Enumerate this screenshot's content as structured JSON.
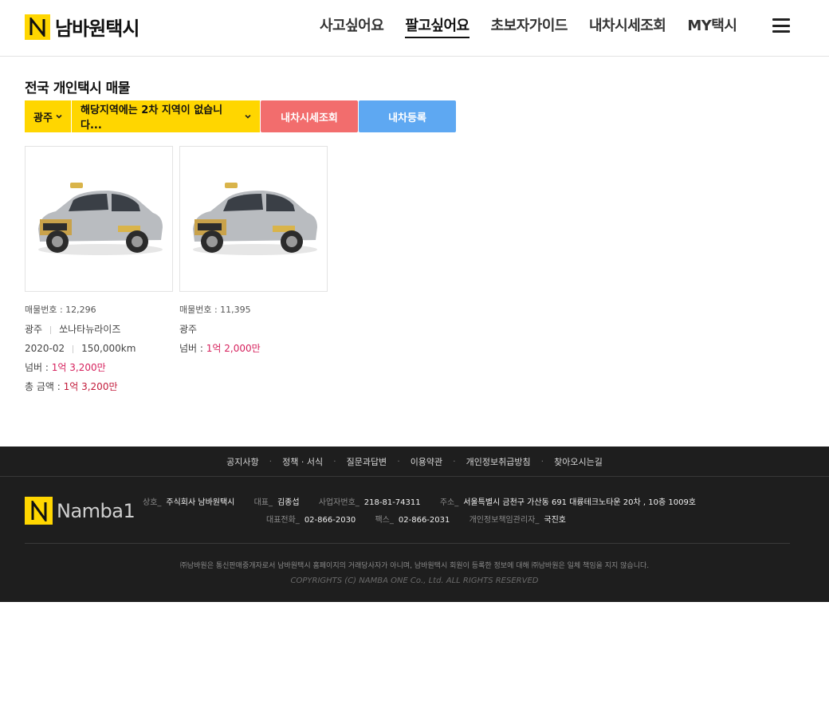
{
  "brand": {
    "name": "남바원택시",
    "footer_name": "Namba1"
  },
  "nav": {
    "items": [
      {
        "label": "사고싶어요",
        "active": false
      },
      {
        "label": "팔고싶어요",
        "active": true
      },
      {
        "label": "초보자가이드",
        "active": false
      },
      {
        "label": "내차시세조회",
        "active": false
      },
      {
        "label": "MY택시",
        "active": false
      }
    ]
  },
  "main": {
    "title": "전국 개인택시 매물",
    "filters": {
      "region": "광주",
      "sub_region": "해당지역에는 2차 지역이 없습니다...",
      "price_button": "내차시세조회",
      "register_button": "내차등록"
    },
    "listings": [
      {
        "number_label": "매물번호 : 12,296",
        "region": "광주",
        "model": "쏘나타뉴라이즈",
        "year": "2020-02",
        "mileage": "150,000km",
        "plate_label": "넘버 : ",
        "plate_price": "1억 3,200만",
        "total_label": "총 금액 : ",
        "total_price": "1억 3,200만"
      },
      {
        "number_label": "매물번호 : 11,395",
        "region": "광주",
        "plate_label": "넘버 : ",
        "plate_price": "1억 2,000만"
      }
    ]
  },
  "footer": {
    "links": [
      "공지사항",
      "정책 · 서식",
      "질문과답변",
      "이용약관",
      "개인정보취급방침",
      "찾아오시는길"
    ],
    "company_label": "상호_",
    "company": "주식회사 남바원택시",
    "ceo_label": "대표_",
    "ceo": "김종섭",
    "bizno_label": "사업자번호_",
    "bizno": "218-81-74311",
    "address_label": "주소_",
    "address": "서울특별시 금천구 가산동 691 대륭테크노타운 20차 , 10층 1009호",
    "tel_label": "대표전화_",
    "tel": "02-866-2030",
    "fax_label": "팩스_",
    "fax": "02-866-2031",
    "privacy_label": "개인정보책임관리자_",
    "privacy_manager": "국진호",
    "notice": "㈜남바원은 통신판매중개자로서 남바원택시 홈페이지의 거래당사자가 아니며, 남바원택시 회원이 등록한 정보에 대해 ㈜남바원은 일체 책임을 지지 않습니다.",
    "copyright": "COPYRIGHTS (C) NAMBA ONE Co., Ltd. ALL RIGHTS RESERVED"
  },
  "colors": {
    "brand_yellow": "#ffd600",
    "price_button": "#f26d6d",
    "register_button": "#5ea8f2",
    "price_text": "#d6215d",
    "footer_bg": "#1e1e1e"
  }
}
